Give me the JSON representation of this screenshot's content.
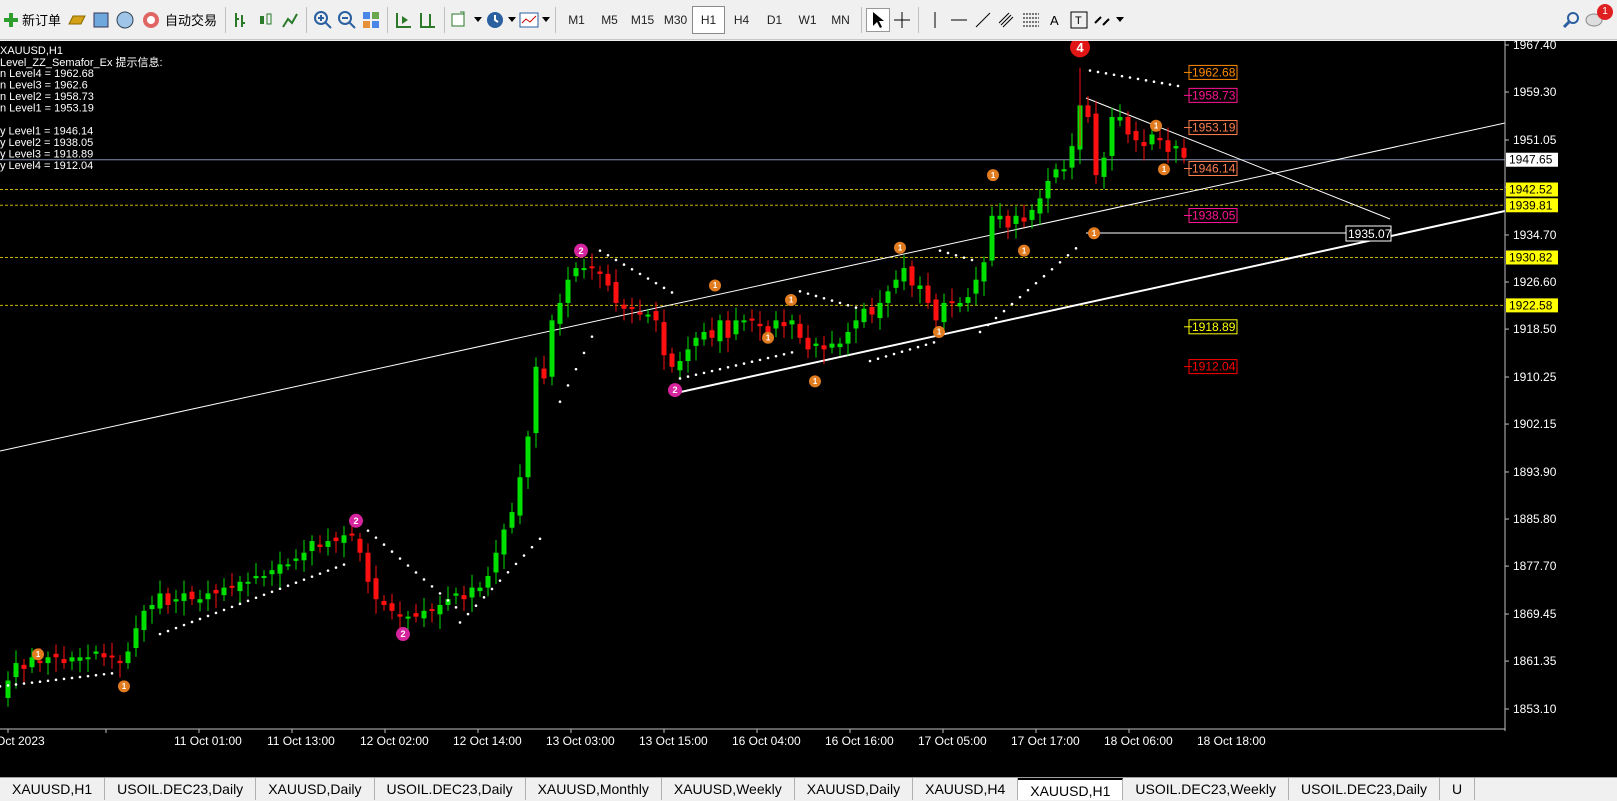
{
  "toolbar": {
    "new_order_label": "新订单",
    "auto_trading_label": "自动交易",
    "timeframes": [
      "M1",
      "M5",
      "M15",
      "M30",
      "H1",
      "H4",
      "D1",
      "W1",
      "MN"
    ],
    "active_timeframe": "H1",
    "notification_count": "1"
  },
  "chart": {
    "title": "XAUUSD,H1",
    "indicator_header": "Level_ZZ_Semafor_Ex 提示信息:",
    "info_lines": [
      "n Level4 = 1962.68",
      "n Level3 = 1962.6",
      "n Level2 = 1958.73",
      "n Level1 = 1953.19",
      "y Level1 = 1946.14",
      "y Level2 = 1938.05",
      "y Level3 = 1918.89",
      "y Level4 = 1912.04"
    ],
    "y_ticks": [
      "1967.40",
      "1959.30",
      "1951.05",
      "1942.95",
      "1934.70",
      "1926.60",
      "1918.50",
      "1910.25",
      "1902.15",
      "1893.90",
      "1885.80",
      "1877.70",
      "1869.45",
      "1861.35",
      "1853.10"
    ],
    "x_ticks": [
      "Oct 2023",
      "11 Oct 01:00",
      "11 Oct 13:00",
      "12 Oct 02:00",
      "12 Oct 14:00",
      "13 Oct 03:00",
      "13 Oct 15:00",
      "16 Oct 04:00",
      "16 Oct 16:00",
      "17 Oct 05:00",
      "17 Oct 17:00",
      "18 Oct 06:00",
      "18 Oct 18:00"
    ],
    "current_price": "1947.65",
    "axis_badges": [
      {
        "text": "1942.52",
        "color": "#ffff00"
      },
      {
        "text": "1939.81",
        "color": "#ffff00"
      },
      {
        "text": "1930.82",
        "color": "#ffff00"
      },
      {
        "text": "1922.58",
        "color": "#ffff00"
      }
    ],
    "level_labels": [
      {
        "text": "1962.68",
        "color": "#ff8c00"
      },
      {
        "text": "1958.73",
        "color": "#ff1493"
      },
      {
        "text": "1953.19",
        "color": "#ff7f50"
      },
      {
        "text": "1946.14",
        "color": "#ff7f50"
      },
      {
        "text": "1938.05",
        "color": "#ff1493"
      },
      {
        "text": "1918.89",
        "color": "#ffff00"
      },
      {
        "text": "1912.04",
        "color": "#ff0000"
      }
    ],
    "line_label": "1935.07",
    "semafor_marks": [
      "1",
      "2",
      "4"
    ]
  },
  "tabs": [
    "XAUUSD,H1",
    "USOIL.DEC23,Daily",
    "XAUUSD,Daily",
    "USOIL.DEC23,Daily",
    "XAUUSD,Monthly",
    "XAUUSD,Weekly",
    "XAUUSD,Daily",
    "XAUUSD,H4",
    "XAUUSD,H1",
    "USOIL.DEC23,Weekly",
    "USOIL.DEC23,Daily",
    "U"
  ],
  "active_tab_index": 8
}
